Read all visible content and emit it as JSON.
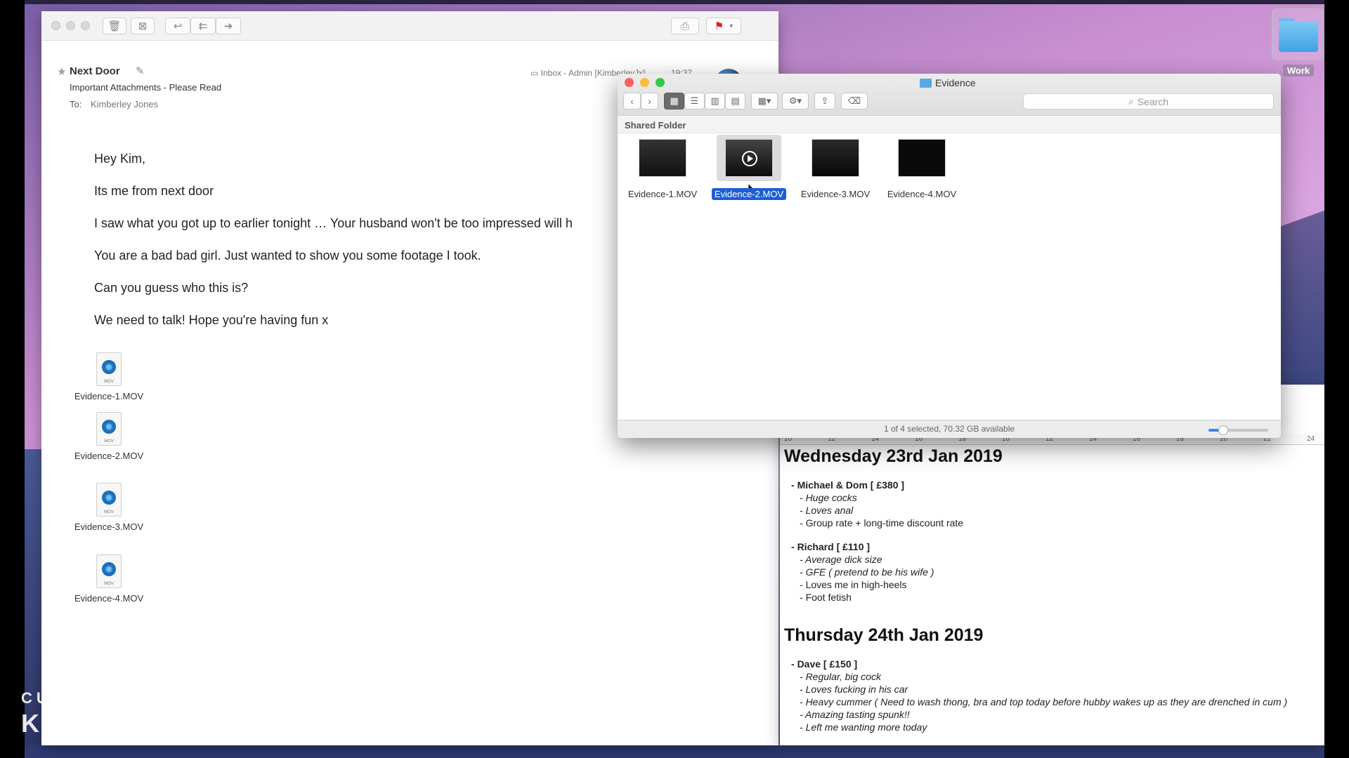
{
  "mail": {
    "from": "Next Door",
    "subject": "Important Attachments - Please Read",
    "to_label": "To:",
    "to": "Kimberley Jones",
    "mailbox": "Inbox - Admin [KimberleyJx]",
    "time": "19:37",
    "body": [
      "Hey Kim,",
      "Its me from next door",
      "I saw what you got up to earlier tonight … Your husband won't be too impressed will h",
      "You are a bad bad girl. Just wanted to show you some footage I took.",
      "Can you guess who this is?",
      "We need to talk! Hope you're having fun x"
    ],
    "attachments": [
      "Evidence-1.MOV",
      "Evidence-2.MOV",
      "Evidence-3.MOV",
      "Evidence-4.MOV"
    ],
    "attachment_badge": "MOV"
  },
  "finder": {
    "title": "Evidence",
    "search_placeholder": "Search",
    "path_label": "Shared Folder",
    "items": [
      {
        "name": "Evidence-1.MOV",
        "selected": false
      },
      {
        "name": "Evidence-2.MOV",
        "selected": true
      },
      {
        "name": "Evidence-3.MOV",
        "selected": false
      },
      {
        "name": "Evidence-4.MOV",
        "selected": false
      }
    ],
    "status": "1 of 4 selected, 70.32 GB available",
    "icon_size_fraction": 0.25
  },
  "notes": {
    "ruler": [
      "10",
      "12",
      "14",
      "16",
      "18",
      "10",
      "12",
      "14",
      "16",
      "18",
      "20",
      "22",
      "24"
    ],
    "day1": {
      "title": "Wednesday 23rd Jan 2019",
      "entries": [
        {
          "head": "Michael & Dom [ £380 ]",
          "lines": [
            {
              "text": "Huge cocks",
              "italic": true
            },
            {
              "text": "Loves anal",
              "italic": true
            },
            {
              "text": "Group rate + long-time discount rate",
              "italic": false
            }
          ]
        },
        {
          "head": "Richard [ £110 ]",
          "lines": [
            {
              "text": "Average dick size",
              "italic": true
            },
            {
              "text": "GFE ( pretend to be his wife )",
              "italic": true
            },
            {
              "text": "Loves me in high-heels",
              "italic": false
            },
            {
              "text": "Foot fetish",
              "italic": false
            }
          ]
        }
      ]
    },
    "day2": {
      "title": "Thursday 24th Jan 2019",
      "entries": [
        {
          "head": "Dave [ £150 ]",
          "lines": [
            {
              "text": "Regular, big cock",
              "italic": true
            },
            {
              "text": "Loves fucking in his car",
              "italic": true
            },
            {
              "text": "Heavy cummer ( Need to wash thong, bra and top today before hubby wakes up as they are drenched in cum )",
              "italic": true
            },
            {
              "text": "Amazing tasting spunk!!",
              "italic": true
            },
            {
              "text": "Left me wanting more today",
              "italic": true
            }
          ]
        }
      ]
    }
  },
  "desktop": {
    "folder_name": "Work",
    "watermark_line1": "CUSTOM VIDEO BY",
    "watermark_line2": "KIMBERLEYJX"
  },
  "colors": {
    "selection": "#1c5fd3",
    "close": "#fc605b",
    "minimize": "#fdbc40",
    "maximize": "#34c84a",
    "flag": "#e0201a"
  },
  "icons": {
    "mail_toolbar": [
      "trash-icon",
      "junk-icon",
      "reply-icon",
      "reply-all-icon",
      "forward-icon",
      "print-icon",
      "flag-icon"
    ],
    "finder_toolbar": [
      "back-icon",
      "forward-icon",
      "icon-view-icon",
      "list-view-icon",
      "column-view-icon",
      "cover-flow-icon",
      "group-icon",
      "gear-icon",
      "share-icon",
      "tag-icon"
    ]
  }
}
